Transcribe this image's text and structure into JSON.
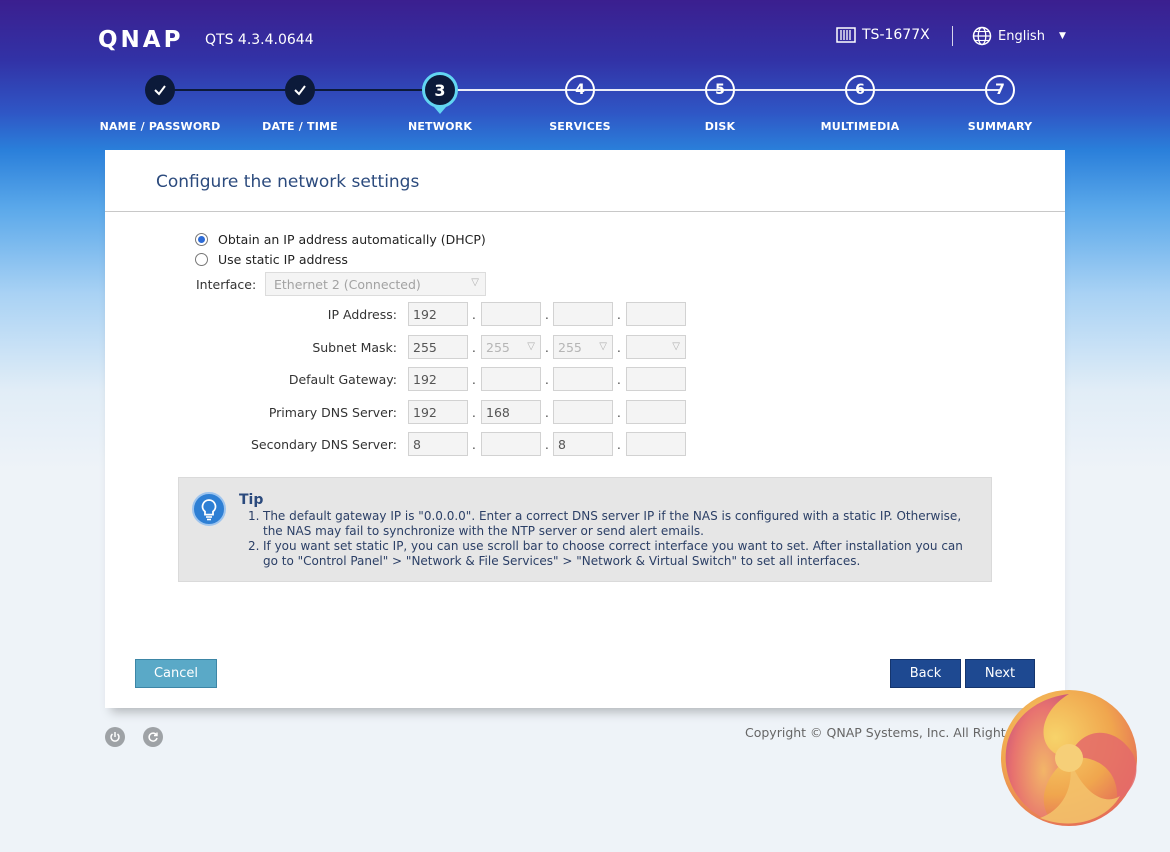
{
  "header": {
    "logo": "QNAP",
    "version": "QTS 4.3.4.0644",
    "model": "TS-1677X",
    "language": "English"
  },
  "steps": [
    {
      "number": "1",
      "label": "NAME / PASSWORD",
      "state": "done"
    },
    {
      "number": "2",
      "label": "DATE / TIME",
      "state": "done"
    },
    {
      "number": "3",
      "label": "NETWORK",
      "state": "active"
    },
    {
      "number": "4",
      "label": "SERVICES",
      "state": "todo"
    },
    {
      "number": "5",
      "label": "DISK",
      "state": "todo"
    },
    {
      "number": "6",
      "label": "MULTIMEDIA",
      "state": "todo"
    },
    {
      "number": "7",
      "label": "SUMMARY",
      "state": "todo"
    }
  ],
  "page": {
    "title": "Configure the network settings",
    "dhcp_option": "Obtain an IP address automatically (DHCP)",
    "static_option": "Use static IP address",
    "selected_option": "dhcp",
    "interface_label": "Interface:",
    "interface_value": "Ethernet 2 (Connected)"
  },
  "fields": [
    {
      "label": "IP Address:",
      "octets": [
        "192",
        "",
        "",
        ""
      ]
    },
    {
      "label": "Subnet Mask:",
      "octets": [
        "255",
        "255",
        "255",
        ""
      ]
    },
    {
      "label": "Default Gateway:",
      "octets": [
        "192",
        "",
        "",
        ""
      ]
    },
    {
      "label": "Primary DNS Server:",
      "octets": [
        "192",
        "168",
        "",
        ""
      ]
    },
    {
      "label": "Secondary DNS Server:",
      "octets": [
        "8",
        "",
        "8",
        ""
      ]
    }
  ],
  "tip": {
    "title": "Tip",
    "items": [
      {
        "num": "1.",
        "text": "The default gateway IP is \"0.0.0.0\". Enter a correct DNS server IP if the NAS is configured with a static IP. Otherwise, the NAS may fail to synchronize with the NTP server or send alert emails."
      },
      {
        "num": "2.",
        "text": "If you want set static IP, you can use scroll bar to choose correct interface you want to set. After installation you can go to \"Control Panel\" > \"Network & File Services\" > \"Network & Virtual Switch\" to set all interfaces."
      }
    ]
  },
  "buttons": {
    "cancel": "Cancel",
    "back": "Back",
    "next": "Next"
  },
  "footer": {
    "copyright": "Copyright © QNAP Systems, Inc. All Rights Reserved."
  },
  "colors": {
    "header_top": "#3b1f8f",
    "step_done": "#0c1a3a",
    "step_active_ring": "#62d5f2",
    "title_blue": "#2b4a7d",
    "button_primary": "#1e4991",
    "button_cancel": "#5aa9c7"
  }
}
